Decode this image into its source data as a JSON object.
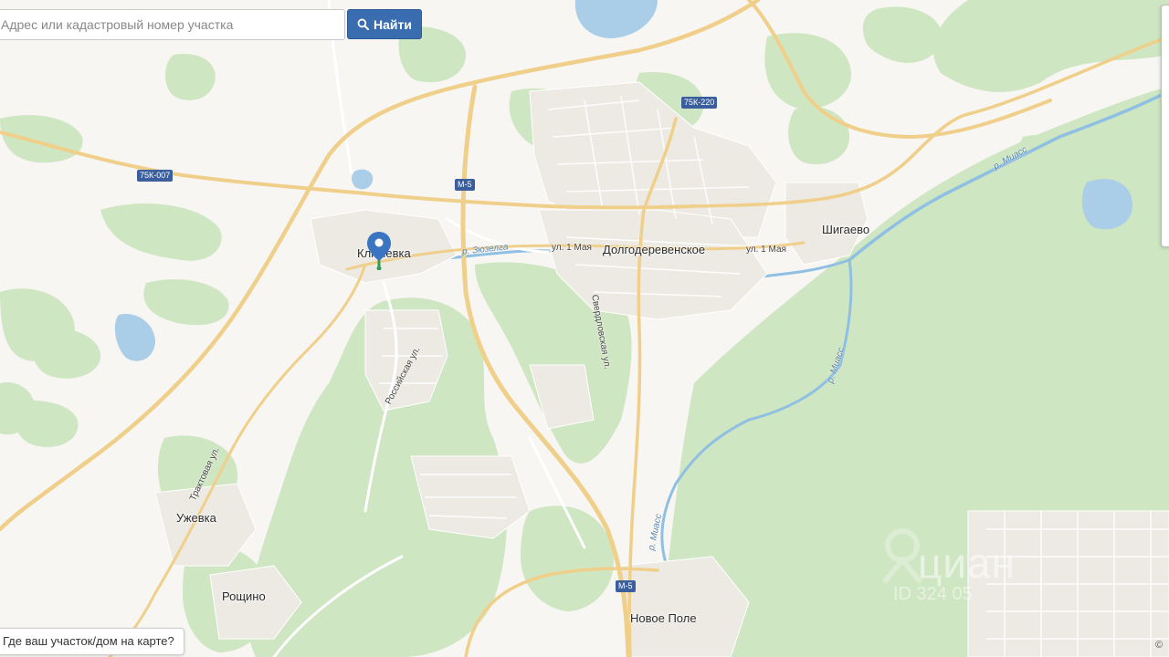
{
  "search": {
    "placeholder": "Адрес или кадастровый номер участка",
    "button_label": "Найти"
  },
  "hint": {
    "text": "Где ваш участок/дом на карте?"
  },
  "copyright": "©",
  "watermark": {
    "brand": "циан",
    "id": "ID 324 05"
  },
  "places": {
    "klyuchevka": "Ключевка",
    "dolgoderevenskoe": "Долгодеревенское",
    "shigaevo": "Шигаево",
    "uzhevka": "Ужевка",
    "roshchino": "Рощино",
    "novoe_pole": "Новое Поле"
  },
  "streets": {
    "may1_west": "ул. 1 Мая",
    "may1_east": "ул. 1 Мая",
    "sverdlovskaya": "Свердловская ул.",
    "rossiyskaya": "Российская ул.",
    "traktovaya": "Трактовая ул."
  },
  "rivers": {
    "zyuzelga": "р. Зюзелга",
    "miass_ne": "р. Миасс",
    "miass_mid": "р. Миасс",
    "miass_s": "р. Миасс"
  },
  "road_shields": {
    "r75k007": "75К-007",
    "r75k220": "75К-220",
    "m5_north": "М-5",
    "m5_south": "М-5"
  },
  "colors": {
    "forest": "#cfe6c2",
    "road_major": "#f0cf8a",
    "water": "#aacde8",
    "button": "#3a6db0",
    "pin": "#3b75c1"
  }
}
